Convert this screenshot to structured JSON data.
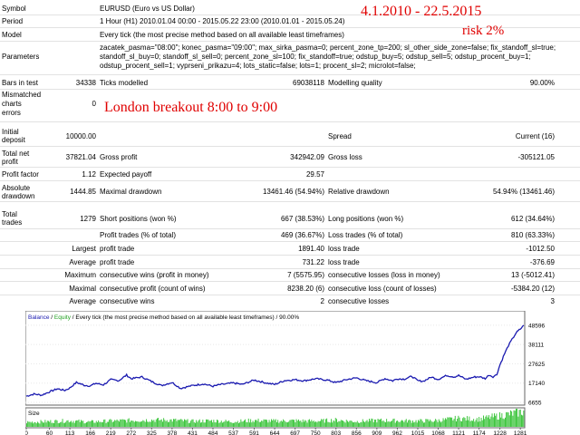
{
  "report": {
    "symbol_label": "Symbol",
    "symbol_value": "EURUSD (Euro vs US Dollar)",
    "period_label": "Period",
    "period_value": "1 Hour (H1) 2010.01.04 00:00 - 2015.05.22 23:00 (2010.01.01 - 2015.05.24)",
    "model_label": "Model",
    "model_value": "Every tick (the most precise method based on all available least timeframes)",
    "parameters_label": "Parameters",
    "parameters_line1": "zacatek_pasma=\"08:00\"; konec_pasma=\"09:00\"; max_sirka_pasma=0; percent_zone_tp=200; sl_other_side_zone=false; fix_standoff_sl=true;",
    "parameters_line2": "standoff_sl_buy=0; standoff_sl_sell=0; percent_zone_sl=100; fix_standoff=true; odstup_buy=5; odstup_sell=5; odstup_procent_buy=1;",
    "parameters_line3": "odstup_procent_sell=1; vyprseni_prikazu=4; lots_static=false; lots=1; procent_sl=2; microlot=false;",
    "bars_label": "Bars in test",
    "bars_value": "34338",
    "ticks_label": "Ticks modelled",
    "ticks_value": "69038118",
    "quality_label": "Modelling quality",
    "quality_value": "90.00%",
    "mismatched_label_1": "Mismatched",
    "mismatched_label_2": "charts",
    "mismatched_label_3": "errors",
    "mismatched_value": "0",
    "initial_label_1": "Initial",
    "initial_label_2": "deposit",
    "initial_value": "10000.00",
    "spread_label": "Spread",
    "spread_value": "Current (16)",
    "netprofit_label_1": "Total net",
    "netprofit_label_2": "profit",
    "netprofit_value": "37821.04",
    "grossprofit_label": "Gross profit",
    "grossprofit_value": "342942.09",
    "grossloss_label": "Gross loss",
    "grossloss_value": "-305121.05",
    "pf_label": "Profit factor",
    "pf_value": "1.12",
    "expected_label": "Expected payoff",
    "expected_value": "29.57",
    "absdd_label_1": "Absolute",
    "absdd_label_2": "drawdown",
    "absdd_value": "1444.85",
    "maxdd_label": "Maximal drawdown",
    "maxdd_value": "13461.46 (54.94%)",
    "reldd_label": "Relative drawdown",
    "reldd_value": "54.94% (13461.46)",
    "trades_label_1": "Total",
    "trades_label_2": "trades",
    "trades_value": "1279",
    "short_label": "Short positions (won %)",
    "short_value": "667 (38.53%)",
    "long_label": "Long positions (won %)",
    "long_value": "612 (34.64%)",
    "ptrades_label": "Profit trades (% of total)",
    "ptrades_value": "469 (36.67%)",
    "ltrades_label": "Loss trades (% of total)",
    "ltrades_value": "810 (63.33%)",
    "largest_label": "Largest",
    "largest_p_label": "profit trade",
    "largest_p_value": "1891.40",
    "largest_l_label": "loss trade",
    "largest_l_value": "-1012.50",
    "average_label": "Average",
    "average_p_label": "profit trade",
    "average_p_value": "731.22",
    "average_l_label": "loss trade",
    "average_l_value": "-376.69",
    "maximum_label": "Maximum",
    "cwins_money_label": "consecutive wins (profit in money)",
    "cwins_money_value": "7 (5575.95)",
    "closses_money_label": "consecutive losses (loss in money)",
    "closses_money_value": "13 (-5012.41)",
    "maximal_label": "Maximal",
    "cprofit_count_label": "consecutive profit (count of wins)",
    "cprofit_count_value": "8238.20 (6)",
    "closs_count_label": "consecutive loss (count of losses)",
    "closs_count_value": "-5384.20 (12)",
    "average2_label": "Average",
    "avg_cwins_label": "consecutive wins",
    "avg_cwins_value": "2",
    "avg_closses_label": "consecutive losses",
    "avg_closses_value": "3"
  },
  "annotations": {
    "dates": "4.1.2010  - 22.5.2015",
    "risk": "risk 2%",
    "strategy": "London breakout 8:00 to 9:00"
  },
  "chart_header": {
    "balance": "Balance",
    "slash1": " / ",
    "equity": "Equity",
    "rest": " / Every tick (the most precise method based on all available least timeframes) / 90.00%"
  },
  "size_label": "Size",
  "colors": {
    "balance": "#1a1ab0",
    "equity": "#20a020",
    "volume": "#2cc02c",
    "annotation": "#e00000"
  },
  "chart_data": {
    "type": "line",
    "ylim": [
      6655,
      50000
    ],
    "y_ticks": [
      "48596",
      "38111",
      "27625",
      "17140",
      "6655"
    ],
    "x_ticks": [
      "0",
      "60",
      "113",
      "166",
      "219",
      "272",
      "325",
      "378",
      "431",
      "484",
      "537",
      "591",
      "644",
      "697",
      "750",
      "803",
      "856",
      "909",
      "962",
      "1015",
      "1068",
      "1121",
      "1174",
      "1228",
      "1281"
    ],
    "series": [
      {
        "x": [
          0,
          20,
          40,
          60,
          80,
          100,
          113,
          130,
          150,
          166,
          180,
          200,
          219,
          240,
          260,
          272,
          300,
          325,
          350,
          378,
          400,
          431,
          460,
          484,
          500,
          537,
          560,
          591,
          620,
          644,
          670,
          697,
          720,
          750,
          780,
          803,
          830,
          856,
          880,
          909,
          930,
          950,
          962,
          980,
          1000,
          1015,
          1030,
          1050,
          1068,
          1090,
          1110,
          1121,
          1140,
          1160,
          1174,
          1190,
          1200,
          1210,
          1220,
          1228,
          1240,
          1250,
          1260,
          1270,
          1281,
          1290
        ],
        "y": [
          10000,
          11200,
          10600,
          12400,
          14000,
          13200,
          14500,
          17500,
          16000,
          15600,
          17000,
          16200,
          19000,
          18500,
          21500,
          19500,
          20500,
          18000,
          15800,
          17500,
          14300,
          15800,
          16700,
          15400,
          16200,
          17200,
          16400,
          18800,
          17300,
          16400,
          18500,
          19000,
          18400,
          19500,
          18800,
          17400,
          19000,
          20000,
          18500,
          17400,
          19600,
          18400,
          19500,
          19300,
          20800,
          18400,
          18200,
          20400,
          19200,
          21300,
          20500,
          21300,
          19200,
          20400,
          20600,
          19600,
          21600,
          20600,
          21800,
          27000,
          33000,
          37500,
          41000,
          44500,
          46500,
          48500
        ]
      }
    ],
    "volume": {
      "x": [
        0,
        60,
        113,
        166,
        219,
        272,
        325,
        378,
        431,
        484,
        537,
        591,
        644,
        697,
        750,
        803,
        856,
        909,
        962,
        1015,
        1068,
        1121,
        1174,
        1228,
        1281,
        1290
      ],
      "y": [
        30,
        35,
        40,
        32,
        38,
        42,
        45,
        44,
        36,
        40,
        34,
        42,
        38,
        40,
        37,
        44,
        35,
        42,
        40,
        38,
        41,
        55,
        50,
        72,
        95,
        100
      ]
    }
  }
}
